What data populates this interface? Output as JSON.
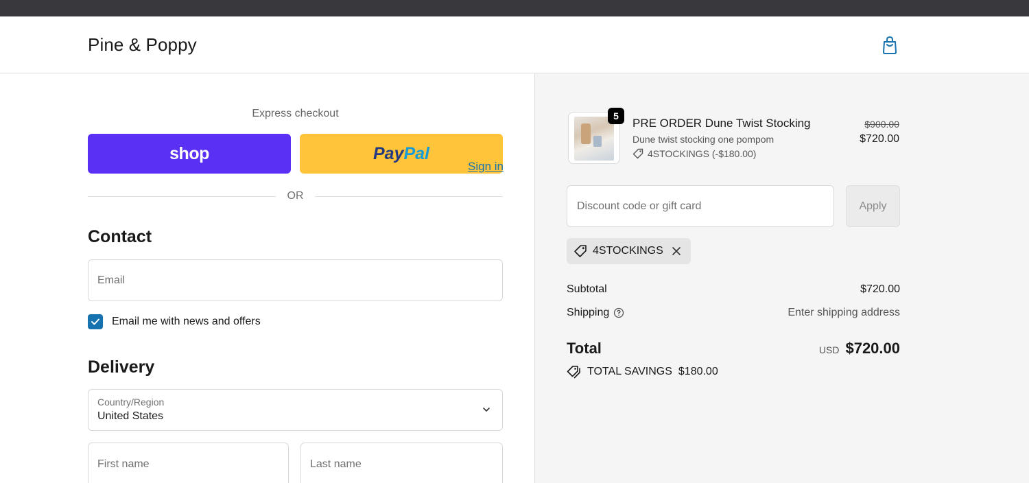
{
  "header": {
    "brand": "Pine & Poppy",
    "cart_icon": "shopping-bag-icon"
  },
  "express": {
    "label": "Express checkout",
    "shop_label": "shop",
    "paypal_label_1": "Pay",
    "paypal_label_2": "Pal",
    "or_label": "OR"
  },
  "contact": {
    "title": "Contact",
    "signin_label": "Sign in",
    "email_placeholder": "Email",
    "newsletter_label": "Email me with news and offers",
    "newsletter_checked": true
  },
  "delivery": {
    "title": "Delivery",
    "country_label": "Country/Region",
    "country_value": "United States",
    "first_name_placeholder": "First name",
    "last_name_placeholder": "Last name"
  },
  "summary": {
    "product": {
      "quantity": "5",
      "name": "PRE ORDER Dune Twist Stocking",
      "variant": "Dune twist stocking one pompom",
      "discount": "4STOCKINGS (-$180.00)",
      "price_original": "$900.00",
      "price_final": "$720.00"
    },
    "discount_placeholder": "Discount code or gift card",
    "apply_label": "Apply",
    "applied_code": "4STOCKINGS",
    "subtotal_label": "Subtotal",
    "subtotal_value": "$720.00",
    "shipping_label": "Shipping",
    "shipping_value": "Enter shipping address",
    "total_label": "Total",
    "currency": "USD",
    "total_value": "$720.00",
    "savings_label": "TOTAL SAVINGS",
    "savings_value": "$180.00"
  },
  "colors": {
    "shop_purple": "#5a31f4",
    "paypal_yellow": "#ffc439",
    "link_blue": "#1773b0"
  }
}
